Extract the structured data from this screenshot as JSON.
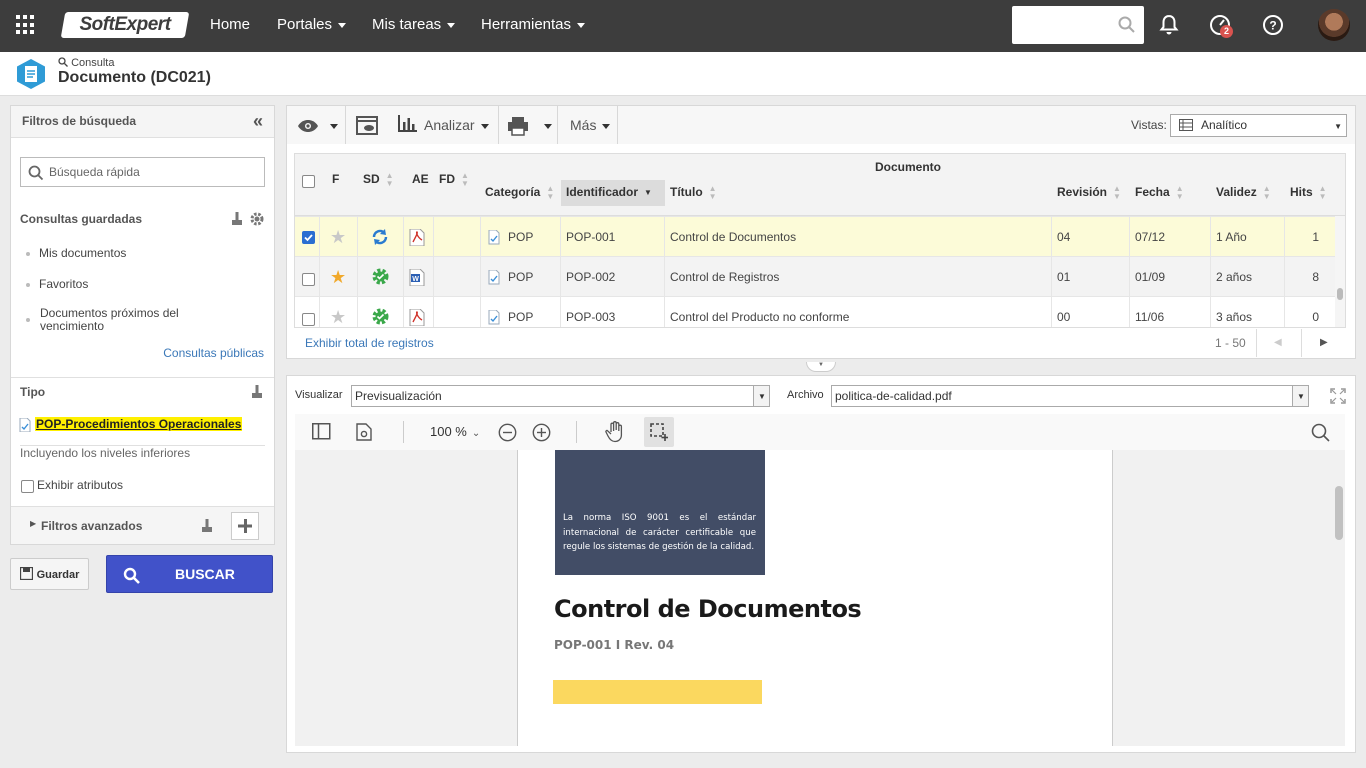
{
  "topbar": {
    "logo": "SoftExpert",
    "nav": [
      {
        "label": "Home",
        "dropdown": false
      },
      {
        "label": "Portales",
        "dropdown": true
      },
      {
        "label": "Mis tareas",
        "dropdown": true
      },
      {
        "label": "Herramientas",
        "dropdown": true
      }
    ],
    "notification_badge": "2"
  },
  "header": {
    "breadcrumb": "Consulta",
    "title": "Documento (DC021)"
  },
  "filters": {
    "title": "Filtros de búsqueda",
    "quick_search_placeholder": "Búsqueda rápida",
    "saved_title": "Consultas guardadas",
    "saved_items": [
      "Mis documentos",
      "Favoritos",
      "Documentos próximos del vencimiento"
    ],
    "public_link": "Consultas públicas",
    "tipo_title": "Tipo",
    "tipo_value": "POP-Procedimientos Operacionales",
    "include_levels": "Incluyendo los niveles inferiores",
    "show_attributes": "Exhibir atributos",
    "advanced": "Filtros avanzados",
    "save_label": "Guardar",
    "search_label": "BUSCAR"
  },
  "toolbar": {
    "analyze": "Analizar",
    "more": "Más",
    "views_label": "Vistas:",
    "view_value": "Analítico"
  },
  "grid": {
    "group_header": "Documento",
    "columns": {
      "f": "F",
      "sd": "SD",
      "ae": "AE",
      "fd": "FD",
      "category": "Categoría",
      "identifier": "Identificador",
      "title": "Título",
      "revision": "Revisión",
      "date": "Fecha",
      "validity": "Validez",
      "hits": "Hits"
    },
    "rows": [
      {
        "checked": true,
        "favorite": false,
        "category": "POP",
        "identifier": "POP-001",
        "title": "Control de Documentos",
        "revision": "04",
        "date": "07/12",
        "validity": "1 Año",
        "hits": "1",
        "file": "pdf"
      },
      {
        "checked": false,
        "favorite": true,
        "category": "POP",
        "identifier": "POP-002",
        "title": "Control de Registros",
        "revision": "01",
        "date": "01/09",
        "validity": "2 años",
        "hits": "8",
        "file": "word"
      },
      {
        "checked": false,
        "favorite": false,
        "category": "POP",
        "identifier": "POP-003",
        "title": "Control del Producto no conforme",
        "revision": "00",
        "date": "11/06",
        "validity": "3 años",
        "hits": "0",
        "file": "pdf"
      }
    ],
    "footer_link": "Exhibir total de registros",
    "pagination": "1 - 50"
  },
  "preview": {
    "viewer_label": "Visualizar",
    "viewer_value": "Previsualización",
    "file_label": "Archivo",
    "file_value": "politica-de-calidad.pdf",
    "zoom": "100 %",
    "pdf": {
      "banner_text": "La norma ISO 9001 es el estándar internacional de carácter certificable que regule los sistemas de gestión de la calidad.",
      "title": "Control de Documentos",
      "subtitle": "POP-001 I Rev. 04"
    }
  },
  "colors": {
    "topbar": "#3d3d3d",
    "accent": "#4152c9",
    "selected_row": "#fcfbd8",
    "pdf_banner": "#424d66",
    "pdf_highlight": "#fbd85f"
  }
}
